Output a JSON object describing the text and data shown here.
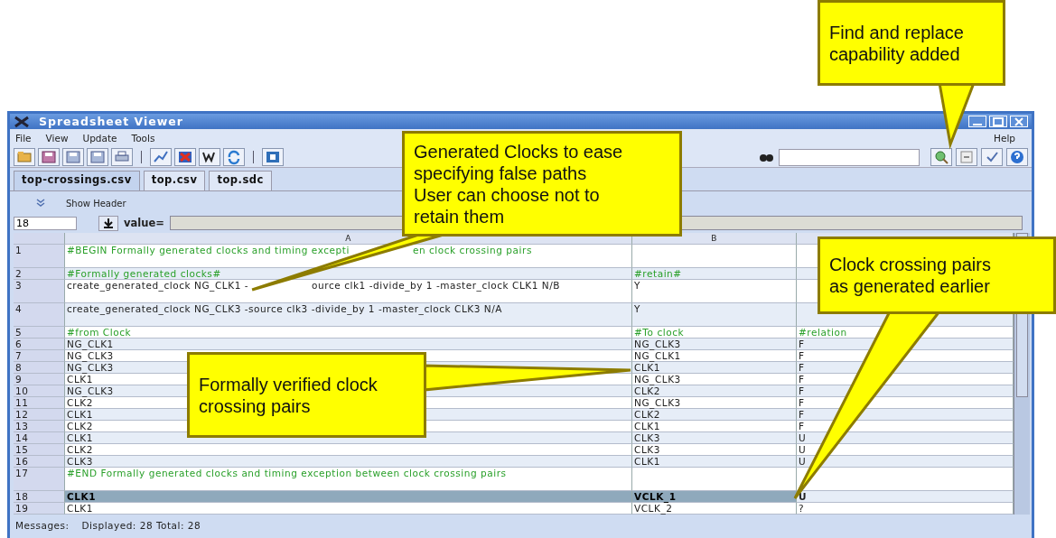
{
  "window": {
    "title": "Spreadsheet Viewer"
  },
  "menu": [
    {
      "label": "File"
    },
    {
      "label": "View"
    },
    {
      "label": "Update"
    },
    {
      "label": "Tools"
    }
  ],
  "help_menu": {
    "label": "Help"
  },
  "tabs": [
    {
      "label": "top-crossings.csv",
      "selected": true
    },
    {
      "label": "top.csv",
      "selected": false
    },
    {
      "label": "top.sdc",
      "selected": false
    }
  ],
  "show_header": {
    "label": "Show Header"
  },
  "cell_bar": {
    "cell": "18",
    "value_label": "value="
  },
  "table": {
    "columns": [
      "A",
      "B"
    ],
    "rows": [
      {
        "num": "1",
        "kind": "header-comment",
        "selected": false,
        "cells": [
          [
            "#BEGIN Formally generated clocks and timing excepti",
            "en clock crossing pairs"
          ],
          "",
          ""
        ]
      },
      {
        "num": "2",
        "kind": "comment",
        "selected": false,
        "cells": [
          "#Formally generated clocks#",
          "#retain#",
          ""
        ]
      },
      {
        "num": "3",
        "kind": "command",
        "selected": false,
        "cells": [
          [
            "create_generated_clock NG_CLK1 -",
            "ource clk1 -divide_by 1 -master_clock CLK1 N/B"
          ],
          "Y",
          ""
        ]
      },
      {
        "num": "4",
        "kind": "command",
        "selected": false,
        "cells": [
          "create_generated_clock NG_CLK3 -source clk3 -divide_by 1 -master_clock CLK3 N/A",
          "Y",
          ""
        ]
      },
      {
        "num": "5",
        "kind": "comment",
        "selected": false,
        "cells": [
          "#from Clock",
          "#To clock",
          "#relation"
        ]
      },
      {
        "num": "6",
        "kind": "data",
        "selected": false,
        "cells": [
          "NG_CLK1",
          "NG_CLK3",
          "F"
        ]
      },
      {
        "num": "7",
        "kind": "data",
        "selected": false,
        "cells": [
          "NG_CLK3",
          "NG_CLK1",
          "F"
        ]
      },
      {
        "num": "8",
        "kind": "data",
        "selected": false,
        "cells": [
          "NG_CLK3",
          "CLK1",
          "F"
        ]
      },
      {
        "num": "9",
        "kind": "data",
        "selected": false,
        "cells": [
          "CLK1",
          "NG_CLK3",
          "F"
        ]
      },
      {
        "num": "10",
        "kind": "data",
        "selected": false,
        "cells": [
          "NG_CLK3",
          "CLK2",
          "F"
        ]
      },
      {
        "num": "11",
        "kind": "data",
        "selected": false,
        "cells": [
          "CLK2",
          "NG_CLK3",
          "F"
        ]
      },
      {
        "num": "12",
        "kind": "data",
        "selected": false,
        "cells": [
          "CLK1",
          "CLK2",
          "F"
        ]
      },
      {
        "num": "13",
        "kind": "data",
        "selected": false,
        "cells": [
          "CLK2",
          "CLK1",
          "F"
        ]
      },
      {
        "num": "14",
        "kind": "data",
        "selected": false,
        "cells": [
          "CLK1",
          "CLK3",
          "U"
        ]
      },
      {
        "num": "15",
        "kind": "data",
        "selected": false,
        "cells": [
          "CLK2",
          "CLK3",
          "U"
        ]
      },
      {
        "num": "16",
        "kind": "data",
        "selected": false,
        "cells": [
          "CLK3",
          "CLK1",
          "U"
        ]
      },
      {
        "num": "17",
        "kind": "header-comment",
        "selected": false,
        "cells": [
          "#END Formally generated clocks and timing exception between clock crossing pairs",
          "",
          ""
        ]
      },
      {
        "num": "18",
        "kind": "data",
        "selected": true,
        "cells": [
          "CLK1",
          "VCLK_1",
          "U"
        ]
      },
      {
        "num": "19",
        "kind": "data",
        "selected": false,
        "cells": [
          "CLK1",
          "VCLK_2",
          "?"
        ]
      }
    ]
  },
  "status_bar": {
    "label": "Messages:",
    "text": "Displayed: 28 Total: 28"
  },
  "callouts": [
    {
      "text": "Find and replace\ncapability added"
    },
    {
      "text": "Generated Clocks to ease\nspecifying false paths\nUser can choose not to\nretain them"
    },
    {
      "text": "Formally verified clock\ncrossing pairs"
    },
    {
      "text": "Clock crossing pairs\nas generated earlier"
    }
  ]
}
